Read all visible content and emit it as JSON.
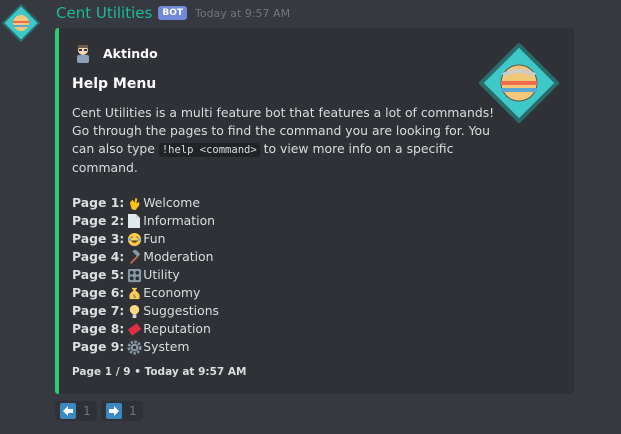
{
  "message": {
    "username": "Cent Utilities",
    "bot_tag": "BOT",
    "timestamp": "Today at 9:57 AM"
  },
  "embed": {
    "author": "Aktindo",
    "title": "Help Menu",
    "description_lines": [
      "Cent Utilities is a multi feature bot that features a lot of commands!",
      "Go through the pages to find the command you are looking for. You"
    ],
    "line3_before": "can also type",
    "line3_code": "!help <command>",
    "line3_after": "to view more info on a specific",
    "line4": "command.",
    "pages": [
      {
        "label": "Page 1:",
        "name": "Welcome",
        "icon": "waving-hand-icon"
      },
      {
        "label": "Page 2:",
        "name": "Information",
        "icon": "page-icon"
      },
      {
        "label": "Page 3:",
        "name": "Fun",
        "icon": "laughing-face-icon"
      },
      {
        "label": "Page 4:",
        "name": "Moderation",
        "icon": "hammer-icon"
      },
      {
        "label": "Page 5:",
        "name": "Utility",
        "icon": "control-knobs-icon"
      },
      {
        "label": "Page 6:",
        "name": "Economy",
        "icon": "money-bag-icon"
      },
      {
        "label": "Page 7:",
        "name": "Suggestions",
        "icon": "light-bulb-icon"
      },
      {
        "label": "Page 8:",
        "name": "Reputation",
        "icon": "ticket-icon"
      },
      {
        "label": "Page 9:",
        "name": "System",
        "icon": "gear-icon"
      }
    ],
    "footer": "Page 1 / 9 • Today at 9:57 AM",
    "accent_color": "#2ecc71"
  },
  "reactions": [
    {
      "icon": "left-arrow-icon",
      "count": "1"
    },
    {
      "icon": "right-arrow-icon",
      "count": "1"
    }
  ]
}
